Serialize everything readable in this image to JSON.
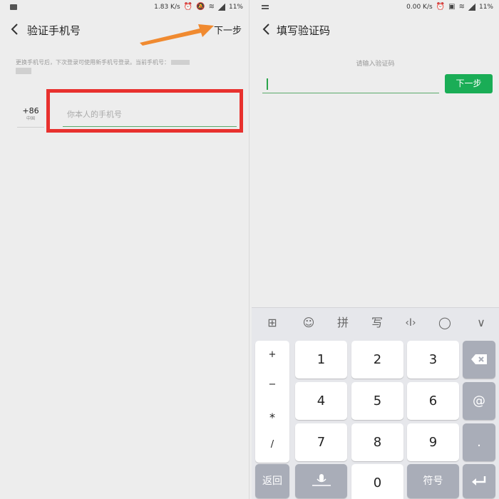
{
  "left": {
    "status": {
      "speed": "1.83 K/s",
      "battery": "11%"
    },
    "title": "验证手机号",
    "next_link": "下一步",
    "hint_text": "更换手机号后，下次登录可使用新手机号登录。当前手机号：",
    "country_code": "+86",
    "country_sub": "中国",
    "phone_placeholder": "你本人的手机号"
  },
  "right": {
    "status": {
      "speed": "0.00 K/s",
      "battery": "11%"
    },
    "title": "填写验证码",
    "code_hint": "请输入验证码",
    "next_button": "下一步",
    "keyboard": {
      "toolbar": [
        {
          "name": "grid-icon",
          "glyph": "⊞"
        },
        {
          "name": "emoji-icon",
          "glyph": "☺"
        },
        {
          "name": "pinyin-icon",
          "glyph": "拼"
        },
        {
          "name": "handwrite-icon",
          "glyph": "写"
        },
        {
          "name": "cursor-icon",
          "glyph": "‹I›"
        },
        {
          "name": "search-icon",
          "glyph": "◯"
        },
        {
          "name": "collapse-icon",
          "glyph": "∨"
        }
      ],
      "symbols": [
        "+",
        "−",
        "*",
        "/"
      ],
      "digits": [
        "1",
        "2",
        "3",
        "4",
        "5",
        "6",
        "7",
        "8",
        "9",
        "0"
      ],
      "right_keys": {
        "at": "@",
        "dot": "."
      },
      "back_label": "返回",
      "symbol_label": "符号"
    }
  }
}
